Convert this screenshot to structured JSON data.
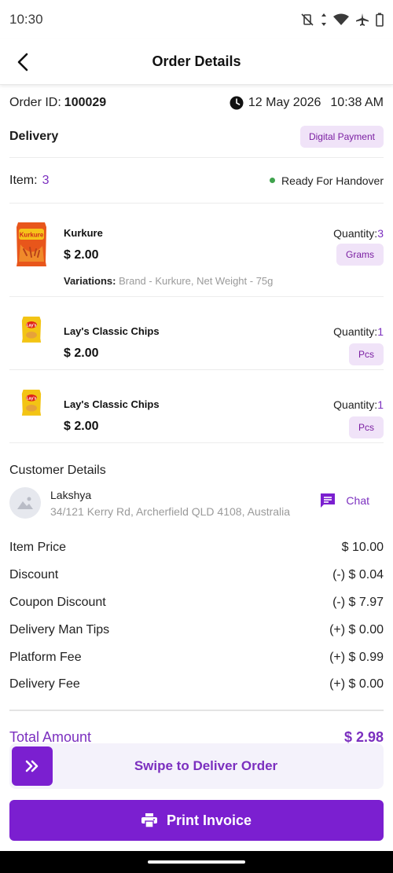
{
  "status_bar": {
    "time": "10:30"
  },
  "header": {
    "title": "Order Details"
  },
  "order": {
    "id_label": "Order ID:",
    "id_value": "100029",
    "date": "12 May 2026",
    "time": "10:38 AM",
    "delivery_label": "Delivery",
    "payment_badge": "Digital Payment",
    "items_label": "Item:",
    "items_count": "3",
    "status": "Ready For Handover"
  },
  "products": [
    {
      "name": "Kurkure",
      "price": "$ 2.00",
      "quantity_label": "Quantity:",
      "quantity": "3",
      "unit": "Grams",
      "variations_label": "Variations:",
      "variations_value": "Brand - Kurkure,  Net Weight - 75g",
      "icon": "kurkure-pack-icon"
    },
    {
      "name": "Lay's Classic Chips",
      "price": "$ 2.00",
      "quantity_label": "Quantity:",
      "quantity": "1",
      "unit": "Pcs",
      "icon": "lays-pack-icon"
    },
    {
      "name": "Lay's Classic Chips",
      "price": "$ 2.00",
      "quantity_label": "Quantity:",
      "quantity": "1",
      "unit": "Pcs",
      "icon": "lays-pack-icon"
    }
  ],
  "customer": {
    "heading": "Customer Details",
    "name": "Lakshya",
    "address": "34/121 Kerry Rd, Archerfield QLD 4108, Australia",
    "chat_label": "Chat"
  },
  "pricing": [
    {
      "label": "Item Price",
      "value": "$ 10.00"
    },
    {
      "label": "Discount",
      "value": "(-) $ 0.04"
    },
    {
      "label": "Coupon Discount",
      "value": "(-) $ 7.97"
    },
    {
      "label": "Delivery Man Tips",
      "value": "(+) $ 0.00"
    },
    {
      "label": "Platform Fee",
      "value": "(+) $ 0.99"
    },
    {
      "label": "Delivery Fee",
      "value": "(+) $ 0.00"
    }
  ],
  "total": {
    "label": "Total Amount",
    "value": "$ 2.98"
  },
  "actions": {
    "swipe_label": "Swipe to Deliver Order",
    "print_label": "Print Invoice"
  },
  "colors": {
    "accent": "#7b1fd0",
    "accent_text": "#7b2fbf",
    "badge_bg": "#f0e3f8",
    "status_dot": "#3fa34d"
  }
}
